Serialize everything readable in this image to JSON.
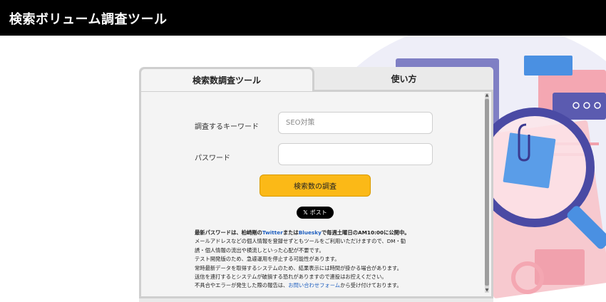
{
  "header": {
    "title": "検索ボリューム調査ツール"
  },
  "tabs": [
    {
      "label": "検索数調査ツール",
      "active": true
    },
    {
      "label": "使い方",
      "active": false
    }
  ],
  "form": {
    "keyword_label": "調査するキーワード",
    "keyword_placeholder": "SEO対策",
    "keyword_value": "",
    "password_label": "パスワード",
    "password_value": "",
    "submit_label": "検索数の調査",
    "post_label": "ポスト",
    "post_icon": "x-logo-icon"
  },
  "notes": {
    "line1_prefix": "最新パスワードは、柏崎剛の",
    "line1_twitter": "Twitter",
    "line1_mid": "または",
    "line1_bluesky": "Bluesky",
    "line1_suffix": "で毎週土曜日のAM10:00に公開中。",
    "line2": "メールアドレスなどの個人情報を登録せずともツールをご利用いただけますので、DM・勧",
    "line3": "誘・個人情報の流出や横流しといった心配が不要です。",
    "line4": "テスト開発版のため、急遽運用を停止する可能性があります。",
    "line5": "常時最新データを取得するシステムのため、結果表示には時間が掛かる場合があります。",
    "line6": "送信を連打するとシステムが破損する恐れがありますので連投はお控えください。",
    "line7_prefix": "不具合やエラーが発生した際の報告は、",
    "line7_link": "お問い合わせフォーム",
    "line7_suffix": "から受け付けております。"
  },
  "colors": {
    "header_bg": "#000000",
    "button": "#fbb917",
    "link": "#1f5fbf"
  }
}
